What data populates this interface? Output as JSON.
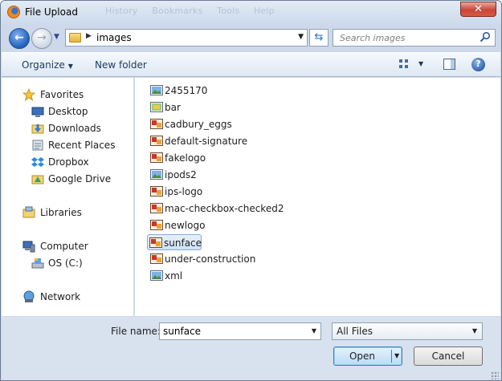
{
  "window": {
    "title": "File Upload",
    "close_label": "✕",
    "background_menu": "History  Bookmarks  Tools  Help"
  },
  "address": {
    "path": "images",
    "search_placeholder": "Search images"
  },
  "toolbar": {
    "organize_label": "Organize",
    "new_folder_label": "New folder"
  },
  "nav": {
    "favorites": {
      "label": "Favorites",
      "items": [
        "Desktop",
        "Downloads",
        "Recent Places",
        "Dropbox",
        "Google Drive"
      ]
    },
    "libraries": {
      "label": "Libraries"
    },
    "computer": {
      "label": "Computer",
      "items": [
        "OS (C:)"
      ]
    },
    "network": {
      "label": "Network"
    }
  },
  "files": [
    {
      "name": "2455170",
      "icon": "image-icon"
    },
    {
      "name": "bar",
      "icon": "image-icon"
    },
    {
      "name": "cadbury_eggs",
      "icon": "paint-icon"
    },
    {
      "name": "default-signature",
      "icon": "paint-icon"
    },
    {
      "name": "fakelogo",
      "icon": "paint-icon"
    },
    {
      "name": "ipods2",
      "icon": "image-icon"
    },
    {
      "name": "ips-logo",
      "icon": "paint-icon"
    },
    {
      "name": "mac-checkbox-checked2",
      "icon": "paint-icon"
    },
    {
      "name": "newlogo",
      "icon": "paint-icon"
    },
    {
      "name": "sunface",
      "icon": "paint-icon",
      "selected": true
    },
    {
      "name": "under-construction",
      "icon": "paint-icon"
    },
    {
      "name": "xml",
      "icon": "image-icon"
    }
  ],
  "footer": {
    "file_name_label": "File name:",
    "file_name_value": "sunface",
    "filter_value": "All Files",
    "open_label": "Open",
    "cancel_label": "Cancel"
  },
  "colors": {
    "window_frame": "#cdd9ea",
    "selection": "#cfe2f8",
    "accent": "#1f5fbf"
  }
}
